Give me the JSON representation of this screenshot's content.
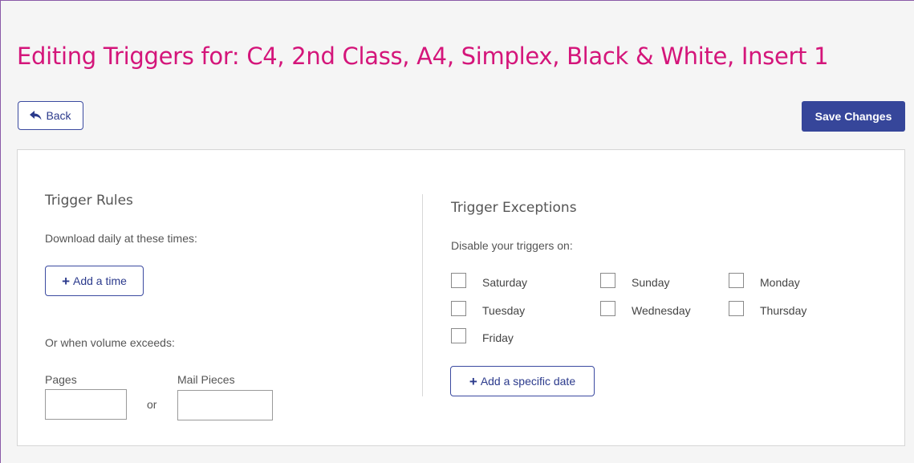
{
  "page": {
    "title": "Editing Triggers for: C4, 2nd Class, A4, Simplex, Black & White, Insert 1"
  },
  "toolbar": {
    "back_label": "Back",
    "save_label": "Save Changes"
  },
  "rules": {
    "heading": "Trigger Rules",
    "daily_label": "Download daily at these times:",
    "add_time_label": "Add a time",
    "volume_label": "Or when volume exceeds:",
    "pages_label": "Pages",
    "pages_value": "",
    "or_label": "or",
    "mail_label": "Mail Pieces",
    "mail_value": ""
  },
  "exceptions": {
    "heading": "Trigger Exceptions",
    "disable_label": "Disable your triggers on:",
    "days": [
      {
        "label": "Saturday",
        "checked": false
      },
      {
        "label": "Sunday",
        "checked": false
      },
      {
        "label": "Monday",
        "checked": false
      },
      {
        "label": "Tuesday",
        "checked": false
      },
      {
        "label": "Wednesday",
        "checked": false
      },
      {
        "label": "Thursday",
        "checked": false
      },
      {
        "label": "Friday",
        "checked": false
      }
    ],
    "add_date_label": "Add a specific date"
  },
  "colors": {
    "title": "#d4157a",
    "primary": "#36469a"
  }
}
